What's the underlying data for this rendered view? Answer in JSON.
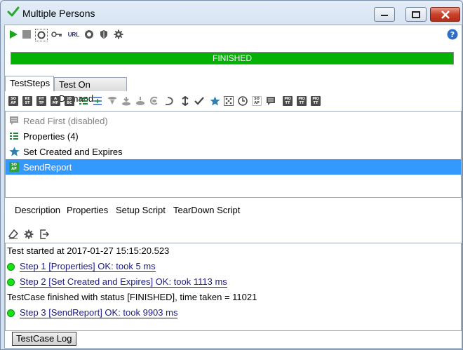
{
  "window": {
    "title": "Multiple Persons"
  },
  "toolbar": {
    "icons": [
      "run-icon",
      "stop-icon",
      "options-icon",
      "key-icon",
      "url-icon",
      "loadui-icon",
      "security-icon",
      "gear-icon"
    ],
    "url_label": "URL"
  },
  "progress": {
    "label": "FINISHED",
    "fraction": 1.0,
    "color": "#06b106"
  },
  "tabs": {
    "steps": "TestSteps",
    "demand": "Test On Demand"
  },
  "step_toolbar": {
    "soap": [
      "SO",
      "AP"
    ],
    "rest": [
      "RE",
      "ST"
    ],
    "http": [
      "HT",
      "TP"
    ],
    "amf": [
      "A",
      "MF"
    ],
    "jdbc": [
      "JD",
      "BC"
    ],
    "mqtt": [
      "MQ",
      "TT"
    ],
    "soap_small": [
      "SO",
      "AP"
    ]
  },
  "steps": [
    {
      "label": "Read First (disabled)",
      "icon": "comment-icon",
      "state": "disabled"
    },
    {
      "label": "Properties (4)",
      "icon": "properties-icon",
      "state": "normal"
    },
    {
      "label": "Set Created and Expires",
      "icon": "star-icon",
      "state": "normal"
    },
    {
      "label": "SendReport",
      "icon": "soap-request-icon",
      "state": "selected"
    }
  ],
  "sub_tabs": [
    "Description",
    "Properties",
    "Setup Script",
    "TearDown Script"
  ],
  "log": {
    "lines": [
      {
        "type": "text",
        "text": "Test started at 2017-01-27 15:15:20.523"
      },
      {
        "type": "link",
        "text": "Step 1 [Properties] OK: took 5 ms"
      },
      {
        "type": "link",
        "text": "Step 2 [Set Created and Expires] OK: took 1113 ms"
      },
      {
        "type": "text",
        "text": "TestCase finished with status [FINISHED], time taken = 11021"
      },
      {
        "type": "link",
        "text": "Step 3 [SendReport] OK: took 9903 ms"
      }
    ]
  },
  "log_button": "TestCase Log",
  "colors": {
    "selection": "#3399ff",
    "ok_dot": "#19e019",
    "progress": "#06b106"
  }
}
